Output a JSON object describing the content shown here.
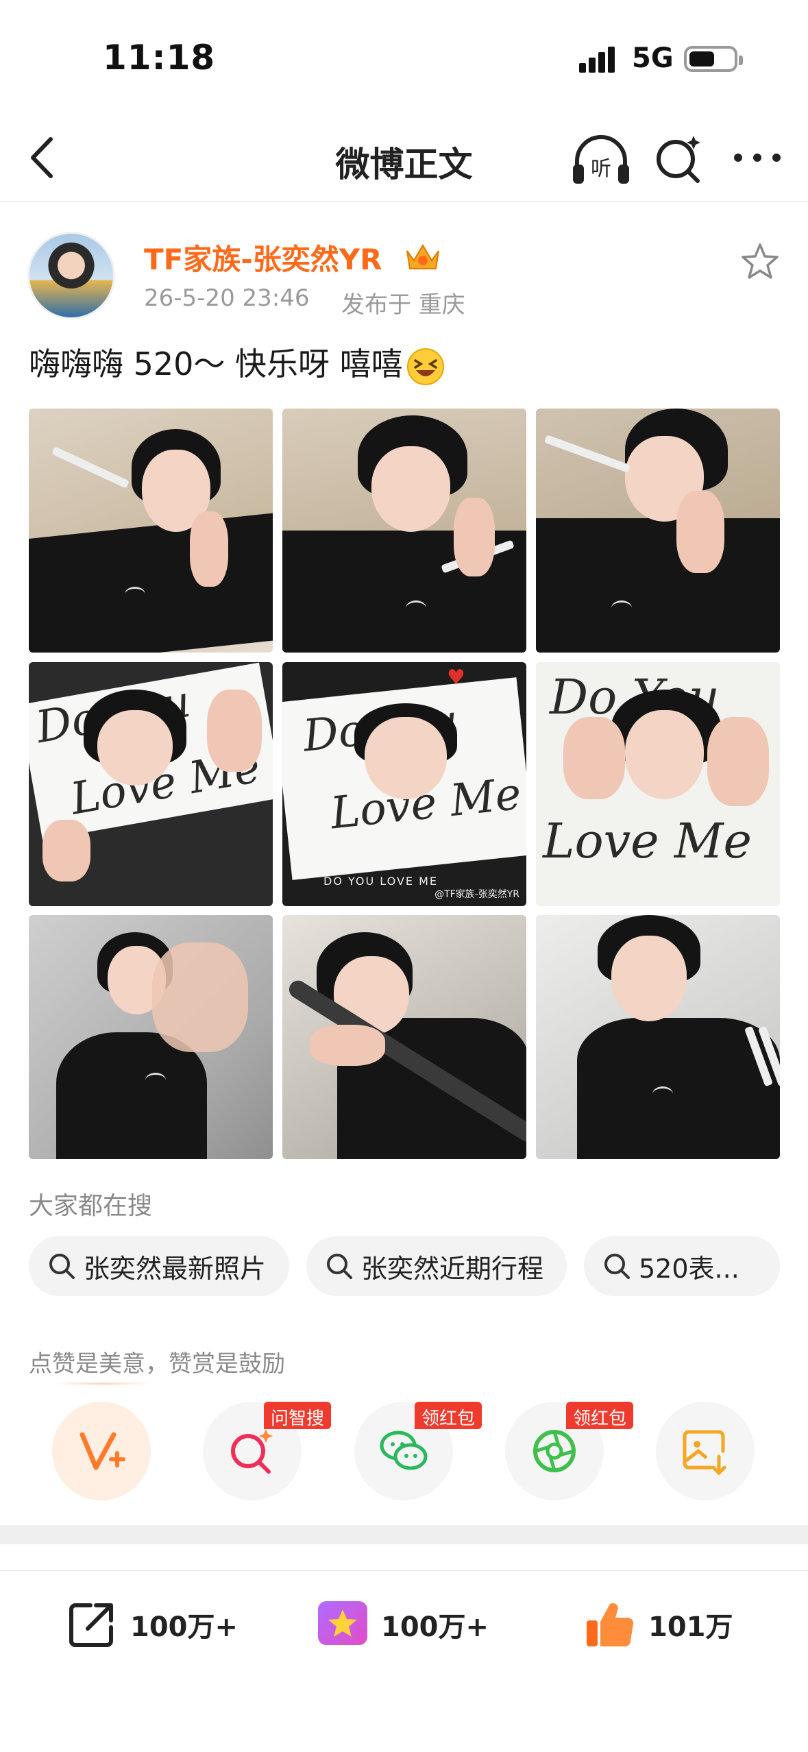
{
  "status_bar": {
    "time": "11:18",
    "network": "5G"
  },
  "nav": {
    "title": "微博正文",
    "listen_label": "听"
  },
  "post": {
    "author": "TF家族-张奕然YR",
    "time": "26-5-20 23:46",
    "location": "发布于 重庆",
    "text": "嗨嗨嗨 520～ 快乐呀 嘻嘻",
    "emoji": "laughing-emoji",
    "photo_count": 9,
    "watermark": "@TF家族-张奕然YR",
    "photo_caption": "DO YOU LOVE ME",
    "scrawl_a": "Do You",
    "scrawl_b": "Love Me"
  },
  "suggestions": {
    "title": "大家都在搜",
    "items": [
      "张奕然最新照片",
      "张奕然近期行程",
      "520表..."
    ]
  },
  "support": {
    "title": "点赞是美意，赞赏是鼓励",
    "buttons": [
      {
        "icon": "v-plus-icon",
        "tag": ""
      },
      {
        "icon": "sparkle-search-icon",
        "tag": "问智搜"
      },
      {
        "icon": "wechat-icon",
        "tag": "领红包"
      },
      {
        "icon": "moments-icon",
        "tag": "领红包"
      },
      {
        "icon": "save-image-icon",
        "tag": ""
      }
    ]
  },
  "actions": {
    "share_count": "100万+",
    "reward_count": "100万+",
    "like_count": "101万"
  },
  "colors": {
    "brand_orange": "#ff6a1a",
    "tag_red": "#f03a2e",
    "like_orange": "#ff6a1a"
  }
}
